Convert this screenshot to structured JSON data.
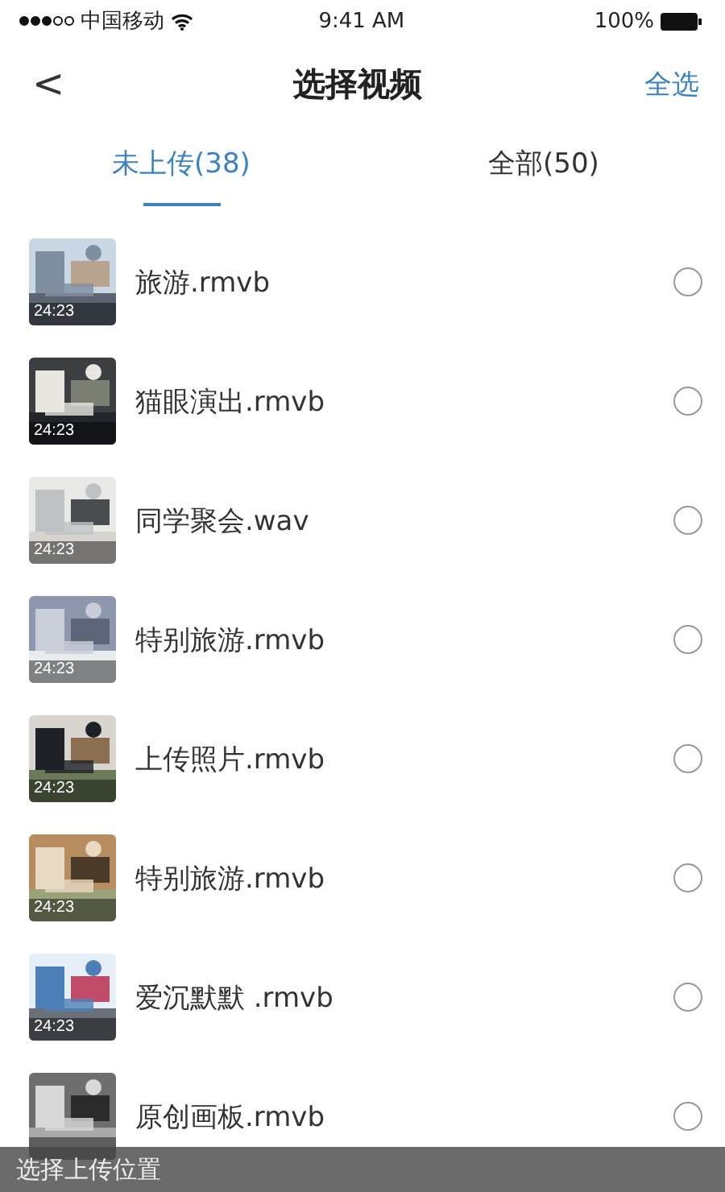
{
  "status_bar": {
    "carrier": "中国移动",
    "time": "9:41 AM",
    "battery": "100%"
  },
  "nav": {
    "back": "<",
    "title": "选择视频",
    "action": "全选"
  },
  "tabs": [
    {
      "label": "未上传(38)",
      "selected": true
    },
    {
      "label": "全部(50)",
      "selected": false
    }
  ],
  "videos": [
    {
      "name": "旅游.rmvb",
      "duration": "24:23",
      "selected": false
    },
    {
      "name": "猫眼演出.rmvb",
      "duration": "24:23",
      "selected": false
    },
    {
      "name": "同学聚会.wav",
      "duration": "24:23",
      "selected": false
    },
    {
      "name": "特别旅游.rmvb",
      "duration": "24:23",
      "selected": false
    },
    {
      "name": "上传照片.rmvb",
      "duration": "24:23",
      "selected": false
    },
    {
      "name": "特别旅游.rmvb",
      "duration": "24:23",
      "selected": false
    },
    {
      "name": "爱沉默默 .rmvb",
      "duration": "24:23",
      "selected": false
    },
    {
      "name": "原创画板.rmvb",
      "selected": false
    }
  ],
  "bottom_bar": {
    "label": "选择上传位置"
  }
}
